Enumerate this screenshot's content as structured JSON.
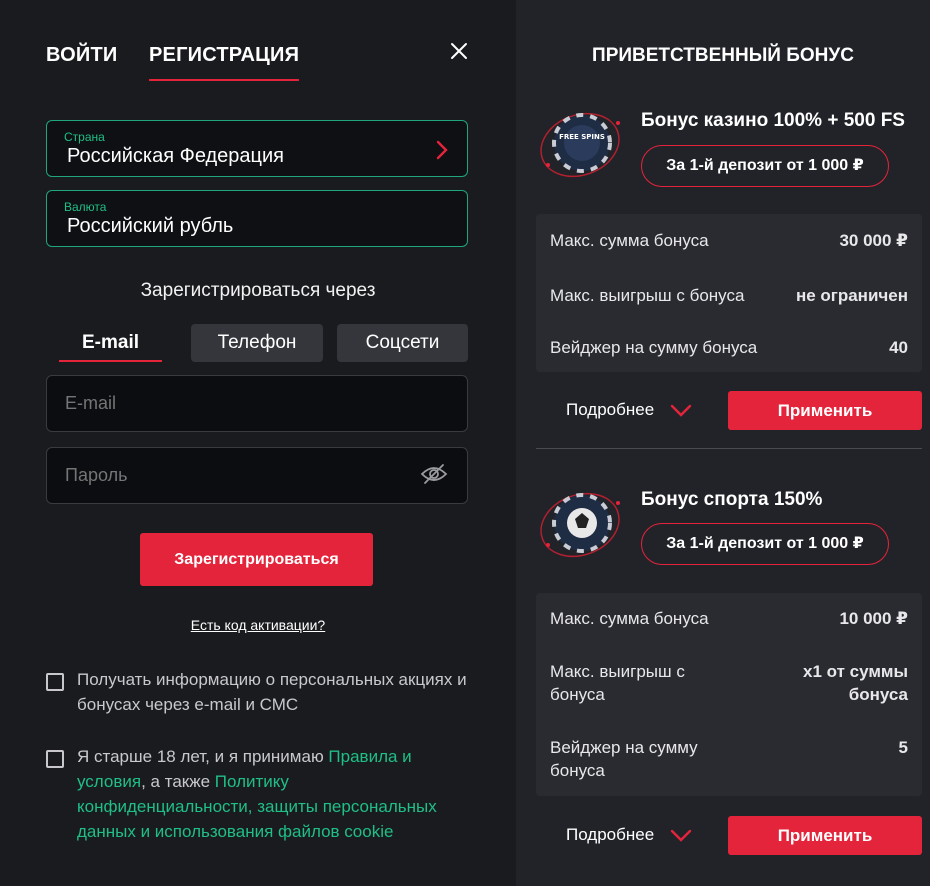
{
  "auth": {
    "tabs": [
      {
        "label": "ВОЙТИ"
      },
      {
        "label": "РЕГИСТРАЦИЯ"
      }
    ],
    "country": {
      "label": "Страна",
      "value": "Российская Федерация"
    },
    "currency": {
      "label": "Валюта",
      "value": "Российский рубль"
    },
    "register_via": "Зарегистрироваться через",
    "methods": [
      {
        "label": "E-mail"
      },
      {
        "label": "Телефон"
      },
      {
        "label": "Соцсети"
      }
    ],
    "email_placeholder": "E-mail",
    "password_placeholder": "Пароль",
    "register_button": "Зарегистрироваться",
    "activation_link": "Есть код активации?",
    "consent_marketing": "Получать информацию о персональных акциях и бонусах через e-mail и СМС",
    "consent_terms": {
      "prefix": "Я старше 18 лет, и я принимаю ",
      "rules_link": "Правила и условия",
      "middle": ", а также ",
      "policy_link": "Политику конфиденциальности, защиты персональных данных и использования файлов cookie"
    }
  },
  "bonus_panel": {
    "title": "ПРИВЕТСТВЕННЫЙ БОНУС",
    "badge_text": "FREE SPINS",
    "bonuses": [
      {
        "name": "Бонус казино 100% + 500 FS",
        "deposit": "За 1-й депозит от 1 000 ₽",
        "rows": [
          {
            "key": "Макс. сумма бонуса",
            "value": "30 000 ₽"
          },
          {
            "key": "Макс. выигрыш с бонуса",
            "value": "не ограничен"
          },
          {
            "key": "Вейджер на сумму бонуса",
            "value": "40"
          }
        ],
        "more": "Подробнее",
        "apply": "Применить"
      },
      {
        "name": "Бонус спорта 150%",
        "deposit": "За 1-й депозит от 1 000 ₽",
        "rows": [
          {
            "key": "Макс. сумма бонуса",
            "value": "10 000 ₽"
          },
          {
            "key": "Макс. выигрыш с бонуса",
            "value": "x1 от суммы бонуса"
          },
          {
            "key": "Вейджер на сумму бонуса",
            "value": "5"
          }
        ],
        "more": "Подробнее",
        "apply": "Применить"
      }
    ]
  },
  "colors": {
    "accent": "#e4243b",
    "green": "#1fbf86",
    "bg": "#1a1b1f",
    "panel": "#222328"
  }
}
